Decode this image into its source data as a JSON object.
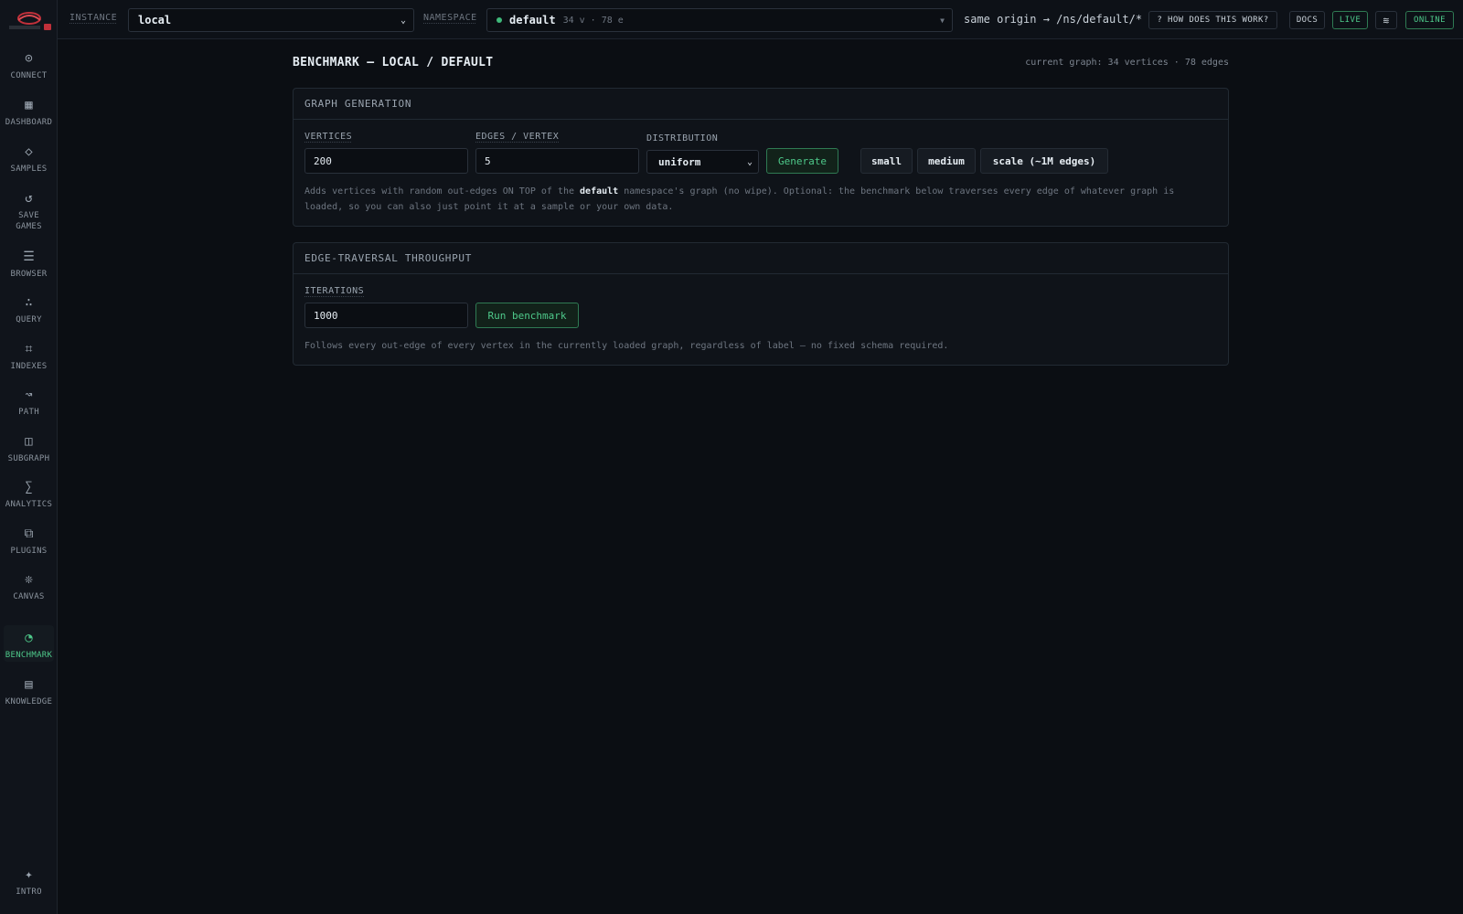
{
  "sidebar": {
    "items": [
      {
        "key": "connect",
        "label": "CONNECT",
        "icon": "⊙"
      },
      {
        "key": "dashboard",
        "label": "DASHBOARD",
        "icon": "▦"
      },
      {
        "key": "samples",
        "label": "SAMPLES",
        "icon": "◇"
      },
      {
        "key": "save-games",
        "label": "SAVE\nGAMES",
        "icon": "↺"
      },
      {
        "key": "browser",
        "label": "BROWSER",
        "icon": "☰"
      },
      {
        "key": "query",
        "label": "QUERY",
        "icon": "∴"
      },
      {
        "key": "indexes",
        "label": "INDEXES",
        "icon": "⌗"
      },
      {
        "key": "path",
        "label": "PATH",
        "icon": "↝"
      },
      {
        "key": "subgraph",
        "label": "SUBGRAPH",
        "icon": "◫"
      },
      {
        "key": "analytics",
        "label": "ANALYTICS",
        "icon": "∑"
      },
      {
        "key": "plugins",
        "label": "PLUGINS",
        "icon": "⧉"
      },
      {
        "key": "canvas",
        "label": "CANVAS",
        "icon": "❊"
      },
      {
        "key": "benchmark",
        "label": "BENCHMARK",
        "icon": "◔"
      },
      {
        "key": "knowledge",
        "label": "KNOWLEDGE",
        "icon": "▤"
      },
      {
        "key": "intro",
        "label": "INTRO",
        "icon": "✦"
      }
    ],
    "active": "benchmark"
  },
  "topbar": {
    "instance_label": "INSTANCE",
    "instance_value": "local",
    "namespace_label": "NAMESPACE",
    "namespace_value": "default",
    "namespace_meta": "34 v · 78 e",
    "origin_text": "same origin → /ns/default/*",
    "help_button": "? HOW DOES THIS WORK?",
    "docs_button": "DOCS",
    "live_button": "LIVE",
    "theme_icon": "≋",
    "status_badge": "ONLINE"
  },
  "page": {
    "title": "BENCHMARK — LOCAL / DEFAULT",
    "graph_info": "current graph: 34 vertices · 78 edges"
  },
  "generation": {
    "heading": "GRAPH GENERATION",
    "vertices_label": "VERTICES",
    "vertices_value": "200",
    "edges_label": "EDGES / VERTEX",
    "edges_value": "5",
    "distribution_label": "DISTRIBUTION",
    "distribution_value": "uniform",
    "generate_button": "Generate",
    "preset_small": "small",
    "preset_medium": "medium",
    "preset_scale": "scale (~1M edges)",
    "help_pre": "Adds vertices with random out-edges ON TOP of the ",
    "help_highlight": "default",
    "help_post": " namespace's graph (no wipe). Optional: the benchmark below traverses every edge of whatever graph is loaded, so you can also just point it at a sample or your own data."
  },
  "traversal": {
    "heading": "EDGE-TRAVERSAL THROUGHPUT",
    "iterations_label": "ITERATIONS",
    "iterations_value": "1000",
    "run_button": "Run benchmark",
    "help": "Follows every out-edge of every vertex in the currently loaded graph, regardless of label — no fixed schema required."
  },
  "colors": {
    "accent": "#4ec98a",
    "background": "#0b0e13",
    "panel": "#0f1319"
  }
}
